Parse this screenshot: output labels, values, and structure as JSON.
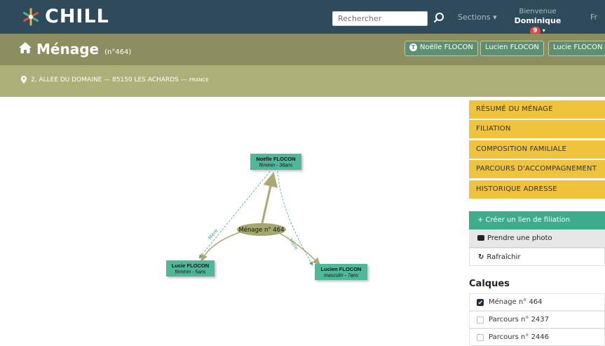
{
  "topbar": {
    "logo_text": "CHILL",
    "search_placeholder": "Rechercher",
    "sections_label": "Sections ▾",
    "welcome_label": "Bienvenue",
    "user_name": "Dominique",
    "notification_count": "9",
    "language": "Fr",
    "colors": {
      "bg": "#2f4a5a"
    }
  },
  "header": {
    "title": "Ménage",
    "subtitle": "(n°464)",
    "persons": [
      {
        "label": "Noëlle FLOCON",
        "chip": "T"
      },
      {
        "label": "Lucien FLOCON"
      },
      {
        "label": "Lucie FLOCON"
      }
    ]
  },
  "address": {
    "text": "2, ALLEE DU DOMAINE — 85150 LES ACHARDS —",
    "country": "France"
  },
  "graph": {
    "household": "Ménage n° 464",
    "nodes": [
      {
        "name": "Noëlle FLOCON",
        "details": "féminin - 38ans"
      },
      {
        "name": "Lucie FLOCON",
        "details": "féminin - 5ans"
      },
      {
        "name": "Lucien FLOCON",
        "details": "masculin - 7ans"
      }
    ],
    "edge_labels": [
      "Mère",
      "Mère"
    ]
  },
  "menu": {
    "items": [
      "RÉSUMÉ DU MÉNAGE",
      "FILIATION",
      "COMPOSITION FAMILIALE",
      "PARCOURS D'ACCOMPAGNEMENT",
      "HISTORIQUE ADRESSE"
    ]
  },
  "actions": {
    "create": "+ Créer un lien de filiation",
    "photo": "Prendre une photo",
    "refresh": "Rafraîchir"
  },
  "calques": {
    "title": "Calques",
    "layers": [
      {
        "label": "Ménage n° 464",
        "checked": true
      },
      {
        "label": "Parcours n° 2437",
        "checked": false
      },
      {
        "label": "Parcours n° 2446",
        "checked": false
      }
    ]
  }
}
